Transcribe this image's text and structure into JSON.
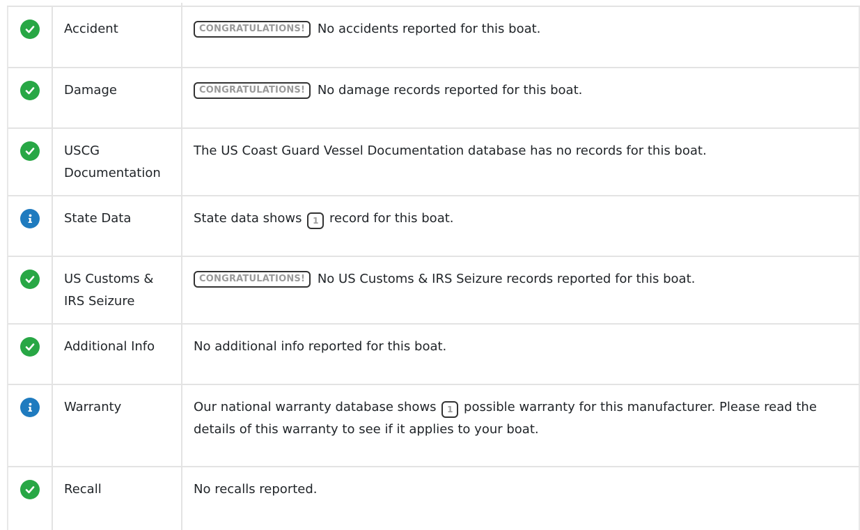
{
  "rows": [
    {
      "status": "check-circle-icon",
      "label": "Accident",
      "badge": "CONGRATULATIONS!",
      "text": "No accidents reported for this boat."
    },
    {
      "status": "check-circle-icon",
      "label": "Damage",
      "badge": "CONGRATULATIONS!",
      "text": "No damage records reported for this boat."
    },
    {
      "status": "check-circle-icon",
      "label": "USCG Documentation",
      "text": "The US Coast Guard Vessel Documentation database has no records for this boat."
    },
    {
      "status": "info-circle-icon",
      "label": "State Data",
      "text_before": "State data shows",
      "count": "1",
      "text_after": "record for this boat."
    },
    {
      "status": "check-circle-icon",
      "label": "US Customs & IRS Seizure",
      "badge": "CONGRATULATIONS!",
      "text": "No US Customs & IRS Seizure records reported for this boat."
    },
    {
      "status": "check-circle-icon",
      "label": "Additional Info",
      "text": "No additional info reported for this boat."
    },
    {
      "status": "info-circle-icon",
      "label": "Warranty",
      "text_before": "Our national warranty database shows",
      "count": "1",
      "text_after": "possible warranty for this manufacturer. Please read the details of this warranty to see if it applies to your boat."
    },
    {
      "status": "check-circle-icon",
      "label": "Recall",
      "text": "No recalls reported."
    }
  ],
  "colors": {
    "ok": "#28a745",
    "info": "#1f7bbf"
  }
}
